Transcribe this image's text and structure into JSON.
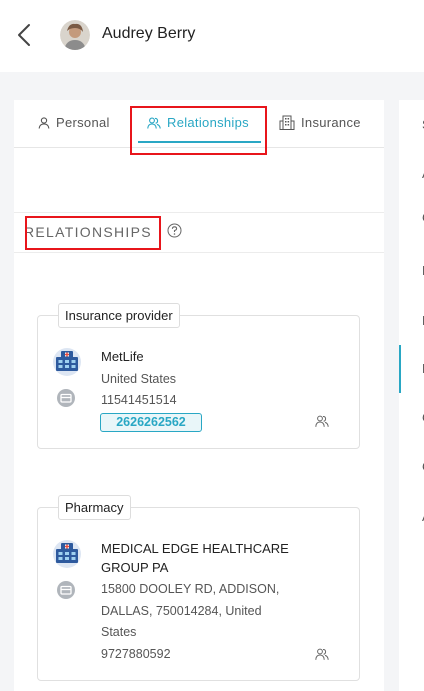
{
  "header": {
    "patient_name": "Audrey Berry"
  },
  "tabs": [
    {
      "label": "Personal",
      "icon": "person-icon"
    },
    {
      "label": "Relationships",
      "icon": "relationships-icon",
      "active": true
    },
    {
      "label": "Insurance",
      "icon": "building-icon"
    }
  ],
  "section": {
    "title": "RELATIONSHIPS"
  },
  "relationships": [
    {
      "type": "Insurance provider",
      "name": "MetLife",
      "lines": [
        "United States",
        "11541451514"
      ],
      "phone_badge": "2626262562"
    },
    {
      "type": "Pharmacy",
      "name_lines": [
        "MEDICAL EDGE HEALTHCARE",
        "GROUP PA"
      ],
      "address_lines": [
        "15800 DOOLEY RD, ADDISON,",
        "DALLAS, 750014284, United",
        "States"
      ],
      "phone": "9727880592"
    }
  ],
  "right_panel": {
    "letters": [
      "S",
      "A",
      "C",
      "P",
      "D",
      "P",
      "C",
      "C",
      "A"
    ]
  },
  "colors": {
    "accent": "#29a7c4",
    "highlight": "#e8151b"
  }
}
